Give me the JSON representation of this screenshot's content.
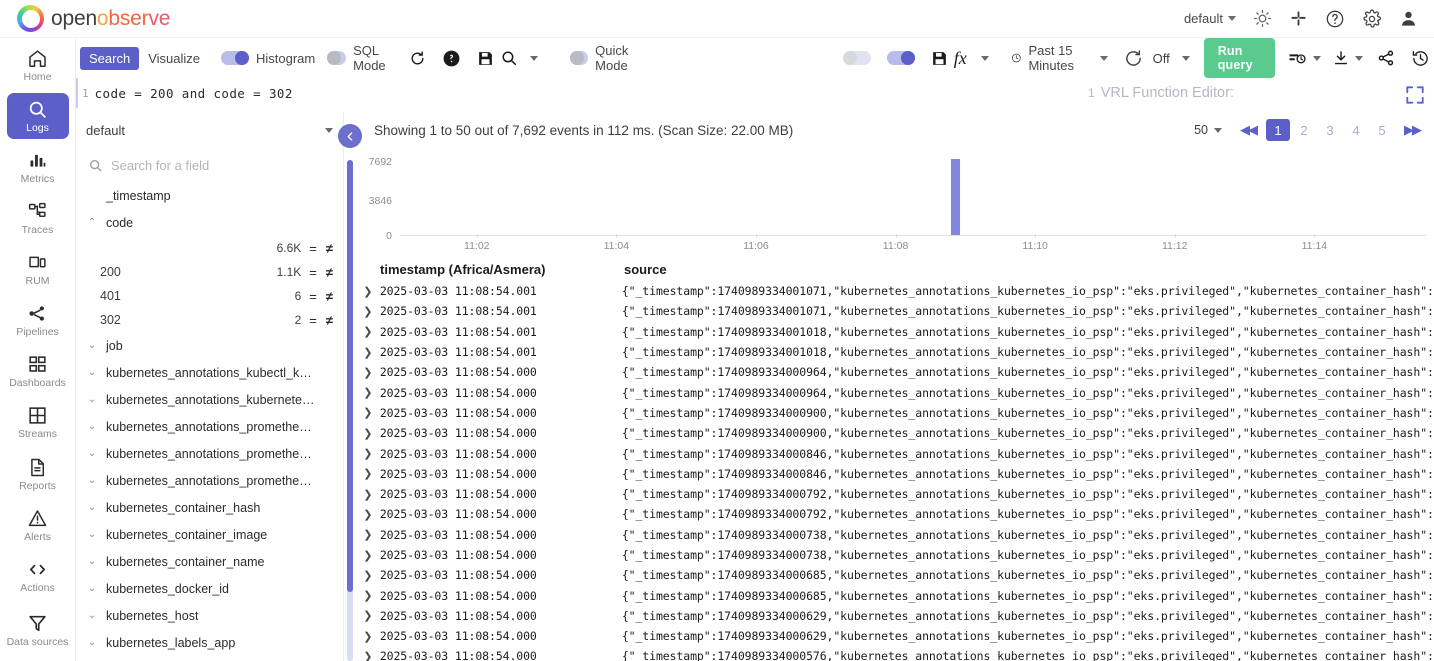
{
  "header": {
    "logo": {
      "part1": "open",
      "part2": "o",
      "part3": "bser",
      "part4": "ve"
    },
    "org": "default",
    "icons": [
      "brightness-icon",
      "slack-icon",
      "help-icon",
      "settings-icon",
      "user-avatar-icon"
    ]
  },
  "toolbar": {
    "search_tab": "Search",
    "visualize_tab": "Visualize",
    "histogram_label": "Histogram",
    "histogram_on": true,
    "sql_mode_label": "SQL Mode",
    "sql_mode_on": false,
    "quick_mode_label": "Quick Mode",
    "quick_mode_on": false,
    "vrl_toggle_on": true,
    "time_range": "Past 15 Minutes",
    "refresh_interval": "Off",
    "run_query": "Run query"
  },
  "query": {
    "line_number": "1",
    "text": "code = 200 and code = 302",
    "vrl_line_number": "1",
    "vrl_placeholder": "VRL Function Editor:"
  },
  "fields": {
    "stream": "default",
    "search_placeholder": "Search for a field",
    "items": [
      {
        "name": "_timestamp",
        "expandable": false,
        "expanded": false
      },
      {
        "name": "code",
        "expandable": true,
        "expanded": true,
        "values": [
          {
            "key": "",
            "count": "6.6K"
          },
          {
            "key": "200",
            "count": "1.1K"
          },
          {
            "key": "401",
            "count": "6"
          },
          {
            "key": "302",
            "count": "2"
          }
        ]
      },
      {
        "name": "job",
        "expandable": true,
        "expanded": false
      },
      {
        "name": "kubernetes_annotations_kubectl_kub…",
        "expandable": true,
        "expanded": false
      },
      {
        "name": "kubernetes_annotations_kubernetes_…",
        "expandable": true,
        "expanded": false
      },
      {
        "name": "kubernetes_annotations_prometheus…",
        "expandable": true,
        "expanded": false
      },
      {
        "name": "kubernetes_annotations_prometheus…",
        "expandable": true,
        "expanded": false
      },
      {
        "name": "kubernetes_annotations_prometheus…",
        "expandable": true,
        "expanded": false
      },
      {
        "name": "kubernetes_container_hash",
        "expandable": true,
        "expanded": false
      },
      {
        "name": "kubernetes_container_image",
        "expandable": true,
        "expanded": false
      },
      {
        "name": "kubernetes_container_name",
        "expandable": true,
        "expanded": false
      },
      {
        "name": "kubernetes_docker_id",
        "expandable": true,
        "expanded": false
      },
      {
        "name": "kubernetes_host",
        "expandable": true,
        "expanded": false
      },
      {
        "name": "kubernetes_labels_app",
        "expandable": true,
        "expanded": false
      }
    ]
  },
  "sidebar": {
    "items": [
      {
        "label": "Home",
        "icon": "home-icon",
        "active": false
      },
      {
        "label": "Logs",
        "icon": "search-icon",
        "active": true
      },
      {
        "label": "Metrics",
        "icon": "bar-chart-icon",
        "active": false
      },
      {
        "label": "Traces",
        "icon": "traces-icon",
        "active": false
      },
      {
        "label": "RUM",
        "icon": "rum-icon",
        "active": false
      },
      {
        "label": "Pipelines",
        "icon": "pipelines-icon",
        "active": false
      },
      {
        "label": "Dashboards",
        "icon": "dashboards-icon",
        "active": false
      },
      {
        "label": "Streams",
        "icon": "streams-icon",
        "active": false
      },
      {
        "label": "Reports",
        "icon": "reports-icon",
        "active": false
      },
      {
        "label": "Alerts",
        "icon": "alerts-icon",
        "active": false
      },
      {
        "label": "Actions",
        "icon": "actions-icon",
        "active": false
      },
      {
        "label": "Data sources",
        "icon": "funnel-icon",
        "active": false
      }
    ]
  },
  "results": {
    "summary": "Showing 1 to 50 out of 7,692 events in 112 ms. (Scan Size: 22.00 MB)",
    "page_size": "50",
    "pages": [
      "1",
      "2",
      "3",
      "4",
      "5"
    ],
    "active_page": "1",
    "columns": {
      "expand": "",
      "timestamp": "timestamp (Africa/Asmera)",
      "source": "source"
    },
    "rows": [
      {
        "ts": "2025-03-03 11:08:54.001",
        "epoch": "1740989334001071"
      },
      {
        "ts": "2025-03-03 11:08:54.001",
        "epoch": "1740989334001071"
      },
      {
        "ts": "2025-03-03 11:08:54.001",
        "epoch": "1740989334001018"
      },
      {
        "ts": "2025-03-03 11:08:54.001",
        "epoch": "1740989334001018"
      },
      {
        "ts": "2025-03-03 11:08:54.000",
        "epoch": "1740989334000964"
      },
      {
        "ts": "2025-03-03 11:08:54.000",
        "epoch": "1740989334000964"
      },
      {
        "ts": "2025-03-03 11:08:54.000",
        "epoch": "1740989334000900"
      },
      {
        "ts": "2025-03-03 11:08:54.000",
        "epoch": "1740989334000900"
      },
      {
        "ts": "2025-03-03 11:08:54.000",
        "epoch": "1740989334000846"
      },
      {
        "ts": "2025-03-03 11:08:54.000",
        "epoch": "1740989334000846"
      },
      {
        "ts": "2025-03-03 11:08:54.000",
        "epoch": "1740989334000792"
      },
      {
        "ts": "2025-03-03 11:08:54.000",
        "epoch": "1740989334000792"
      },
      {
        "ts": "2025-03-03 11:08:54.000",
        "epoch": "1740989334000738"
      },
      {
        "ts": "2025-03-03 11:08:54.000",
        "epoch": "1740989334000738"
      },
      {
        "ts": "2025-03-03 11:08:54.000",
        "epoch": "1740989334000685"
      },
      {
        "ts": "2025-03-03 11:08:54.000",
        "epoch": "1740989334000685"
      },
      {
        "ts": "2025-03-03 11:08:54.000",
        "epoch": "1740989334000629"
      },
      {
        "ts": "2025-03-03 11:08:54.000",
        "epoch": "1740989334000629"
      },
      {
        "ts": "2025-03-03 11:08:54.000",
        "epoch": "1740989334000576"
      }
    ],
    "source_suffix": ",\"kubernetes_annotations_kubernetes_io_psp\":\"eks.privileged\",\"kubernetes_container_hash\":\"",
    "source_prefix": "{\"_timestamp\":"
  },
  "chart_data": {
    "type": "bar",
    "title": "",
    "xlabel": "",
    "ylabel": "",
    "categories": [
      "11:02",
      "11:04",
      "11:06",
      "11:08",
      "11:10",
      "11:12",
      "11:14"
    ],
    "ytick_labels": [
      "7692",
      "3846",
      "0"
    ],
    "ylim": [
      0,
      7692
    ],
    "bars": [
      {
        "x": "11:08.8",
        "value": 7692
      }
    ],
    "bar_color": "#8287dd",
    "grid": false,
    "legend": "none"
  },
  "colors": {
    "accent": "#5b5fc7",
    "run_button": "#5bca8f",
    "bar": "#8287dd"
  }
}
